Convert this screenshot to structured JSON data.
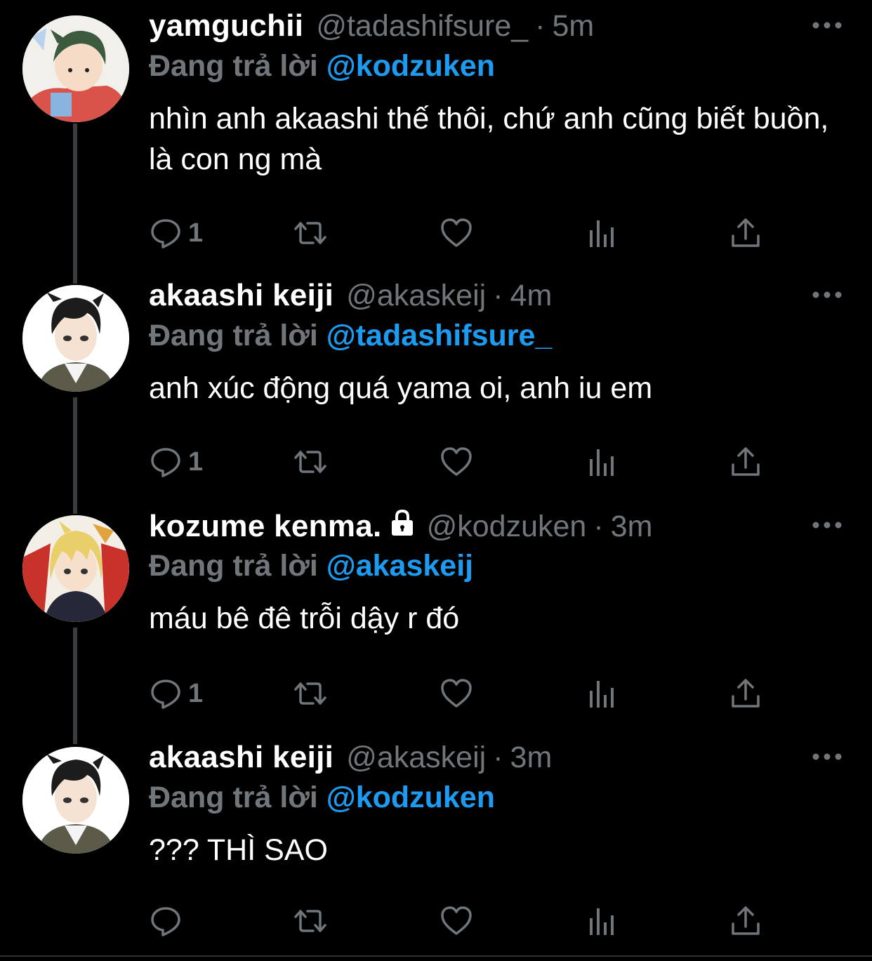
{
  "tweets": [
    {
      "display_name": "yamguchii",
      "handle": "@tadashifsure_",
      "separator": "·",
      "time": "5m",
      "reply_prefix": "Đang trả lời",
      "reply_to": "@kodzuken",
      "text": "nhìn anh akaashi thế thôi, chứ anh cũng biết buồn, là con ng mà",
      "reply_count": "1",
      "locked": false,
      "avatar_icon": "avatar-yamaguchi"
    },
    {
      "display_name": "akaashi keiji",
      "handle": "@akaskeij",
      "separator": "·",
      "time": "4m",
      "reply_prefix": "Đang trả lời",
      "reply_to": "@tadashifsure_",
      "text": "anh xúc động quá yama oi, anh iu em",
      "reply_count": "1",
      "locked": false,
      "avatar_icon": "avatar-akaashi"
    },
    {
      "display_name": "kozume kenma.",
      "handle": "@kodzuken",
      "separator": "·",
      "time": "3m",
      "reply_prefix": "Đang trả lời",
      "reply_to": "@akaskeij",
      "text": "máu bê đê trỗi dậy r đó",
      "reply_count": "1",
      "locked": true,
      "avatar_icon": "avatar-kenma"
    },
    {
      "display_name": "akaashi keiji",
      "handle": "@akaskeij",
      "separator": "·",
      "time": "3m",
      "reply_prefix": "Đang trả lời",
      "reply_to": "@kodzuken",
      "text": "??? THÌ SAO",
      "reply_count": "",
      "locked": false,
      "avatar_icon": "avatar-akaashi"
    }
  ],
  "colors": {
    "background": "#000000",
    "text": "#ffffff",
    "muted": "#71767b",
    "mention": "#1d9bf0",
    "thread_line": "#3a3d40"
  },
  "icons": [
    "reply-icon",
    "retweet-icon",
    "like-icon",
    "analytics-icon",
    "share-icon",
    "more-icon",
    "lock-icon"
  ]
}
